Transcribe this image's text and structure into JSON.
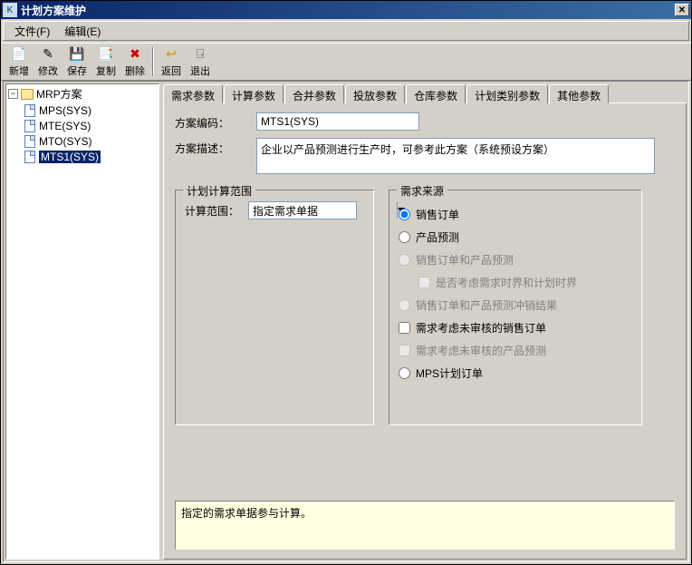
{
  "window": {
    "title": "计划方案维护"
  },
  "menu": {
    "file": "文件(F)",
    "edit": "编辑(E)"
  },
  "toolbar": {
    "new": "新增",
    "modify": "修改",
    "save": "保存",
    "copy": "复制",
    "delete": "删除",
    "back": "返回",
    "exit": "退出"
  },
  "tree": {
    "root": "MRP方案",
    "items": [
      "MPS(SYS)",
      "MTE(SYS)",
      "MTO(SYS)",
      "MTS1(SYS)"
    ],
    "selected_index": 3
  },
  "tabs": [
    "需求参数",
    "计算参数",
    "合并参数",
    "投放参数",
    "仓库参数",
    "计划类别参数",
    "其他参数"
  ],
  "form": {
    "code_label": "方案编码：",
    "code_value": "MTS1(SYS)",
    "desc_label": "方案描述：",
    "desc_value": "企业以产品预测进行生产时，可参考此方案（系统预设方案）"
  },
  "group1": {
    "legend": "计划计算范围",
    "range_label": "计算范围：",
    "range_value": "指定需求单据"
  },
  "group2": {
    "legend": "需求来源",
    "opt_sales": "销售订单",
    "opt_forecast": "产品预测",
    "opt_both": "销售订单和产品预测",
    "chk_time_fence": "是否考虑需求时界和计划时界",
    "opt_net": "销售订单和产品预测冲销结果",
    "chk_unapproved_sales": "需求考虑未审核的销售订单",
    "chk_unapproved_forecast": "需求考虑未审核的产品预测",
    "opt_mps": "MPS计划订单"
  },
  "help": {
    "text": "指定的需求单据参与计算。"
  }
}
